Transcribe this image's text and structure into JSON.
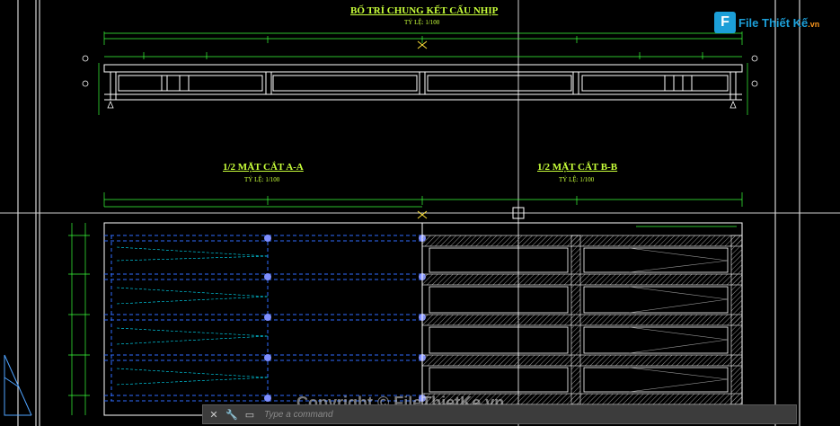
{
  "drawing": {
    "top_title": "BỐ TRÍ CHUNG KẾT CẤU NHỊP",
    "top_scale": "TỶ LỆ: 1/100",
    "section_a_title": "1/2 MẶT CẮT A-A",
    "section_a_scale": "TỶ LỆ: 1/100",
    "section_b_title": "1/2 MẶT CẮT B-B",
    "section_b_scale": "TỶ LỆ: 1/100"
  },
  "logo": {
    "mark": "F",
    "text": "File Thiết Kế",
    "suffix": ".vn"
  },
  "watermark": "Copyright © FileThietKe.vn",
  "command_bar": {
    "placeholder": "Type a command"
  },
  "colors": {
    "background": "#000000",
    "title": "#c8ff3a",
    "beam": "#ffffff",
    "dimension": "#3aff3a",
    "dashed": "#2f6cff",
    "cyan": "#00e5ff",
    "logo": "#1c9fd8"
  },
  "icons": [
    "close-icon",
    "wrench-icon",
    "command-prompt-icon",
    "pickbox-icon"
  ]
}
